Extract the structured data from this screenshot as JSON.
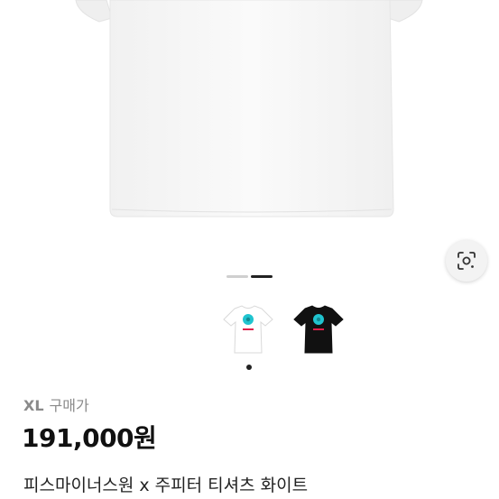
{
  "product": {
    "size_label": "XL",
    "purchase_label": "구매가",
    "price": "191,000원",
    "title": "피스마이너스원 x 주피터 티셔츠 화이트"
  },
  "gallery": {
    "page_count": 2,
    "current_page": 2,
    "thumbnail_count": 2,
    "selected_thumbnail": 1,
    "variants": [
      "white-tshirt",
      "black-tshirt"
    ]
  },
  "icons": {
    "lens": "lens-search-icon"
  },
  "colors": {
    "shirt_white": "#ffffff",
    "shirt_black": "#111111",
    "flower_cyan": "#20c4cf",
    "text_red": "#e0204a",
    "pager_active": "#222222",
    "pager_inactive": "#cfcfcf"
  }
}
